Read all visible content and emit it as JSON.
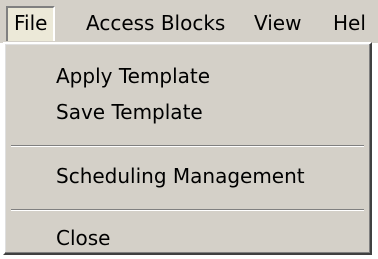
{
  "menubar": {
    "items": [
      {
        "label": "File"
      },
      {
        "label": "Access Blocks"
      },
      {
        "label": "View"
      },
      {
        "label": "Hel"
      }
    ]
  },
  "file_menu": {
    "items": [
      {
        "label": "Apply Template"
      },
      {
        "label": "Save Template"
      },
      {
        "label": "Scheduling Management"
      },
      {
        "label": "Close"
      }
    ]
  }
}
